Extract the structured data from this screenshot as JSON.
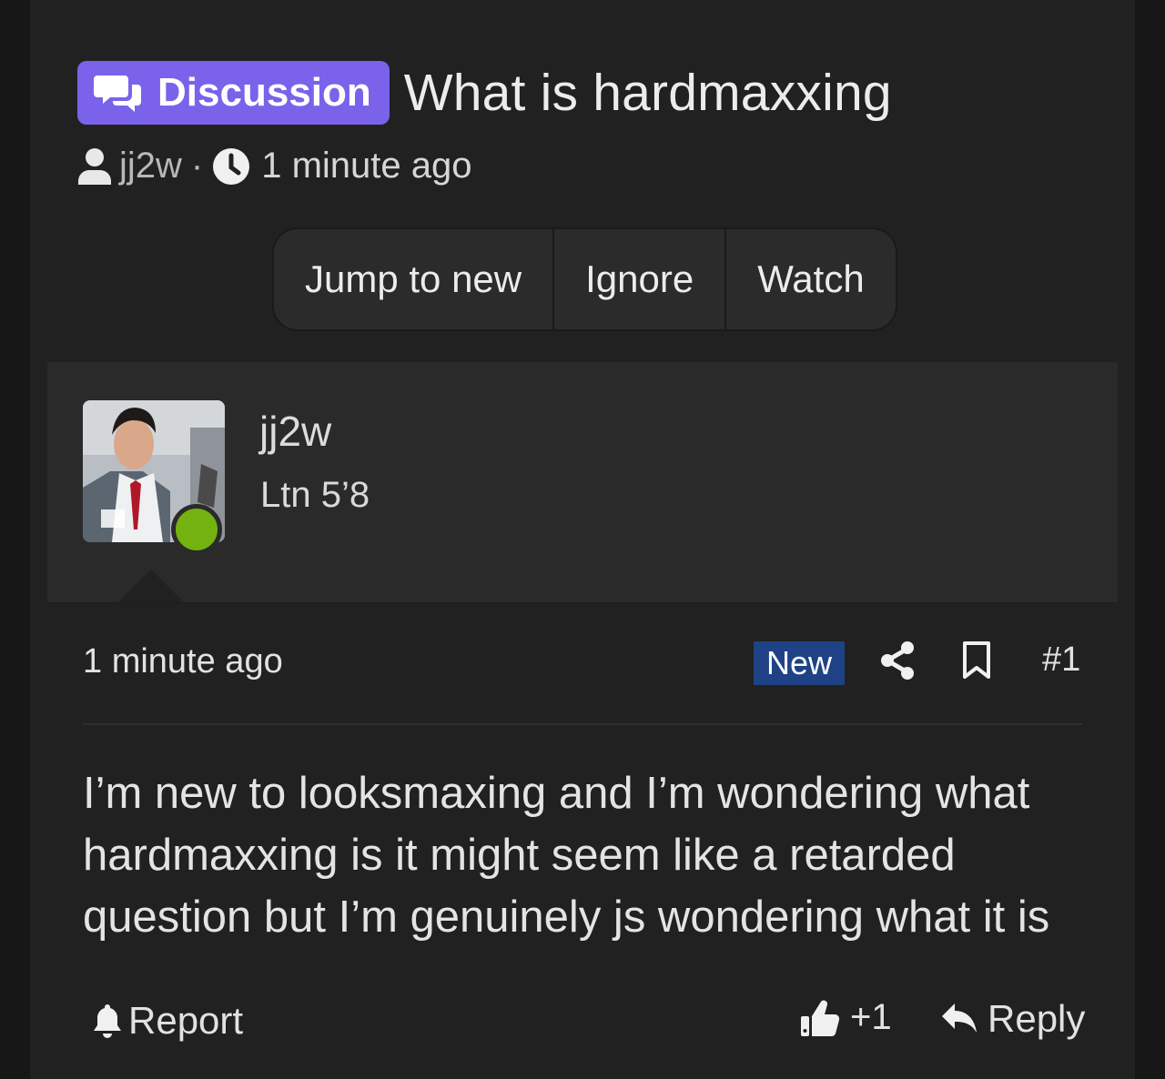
{
  "thread": {
    "prefix_label": "Discussion",
    "title": "What is hardmaxxing",
    "author": "jj2w",
    "separator": "·",
    "time": "1 minute ago"
  },
  "actions": {
    "jump_label": "Jump to new",
    "ignore_label": "Ignore",
    "watch_label": "Watch"
  },
  "post": {
    "username": "jj2w",
    "user_title": "Ltn 5’8",
    "time": "1 minute ago",
    "new_badge": "New",
    "number": "#1",
    "body": "I’m new to looksmaxing and I’m wondering what hardmaxxing is it might seem like a retarded question but I’m genuinely js wondering what it is",
    "report_label": "Report",
    "reaction_count": "+1",
    "reply_label": "Reply"
  },
  "colors": {
    "label_bg": "#7a63ea",
    "new_badge_bg": "#1f4286",
    "online": "#74b20f"
  },
  "icons": [
    "comments-icon",
    "user-icon",
    "clock-icon",
    "share-icon",
    "bookmark-icon",
    "bell-icon",
    "thumbs-up-icon",
    "reply-icon"
  ]
}
